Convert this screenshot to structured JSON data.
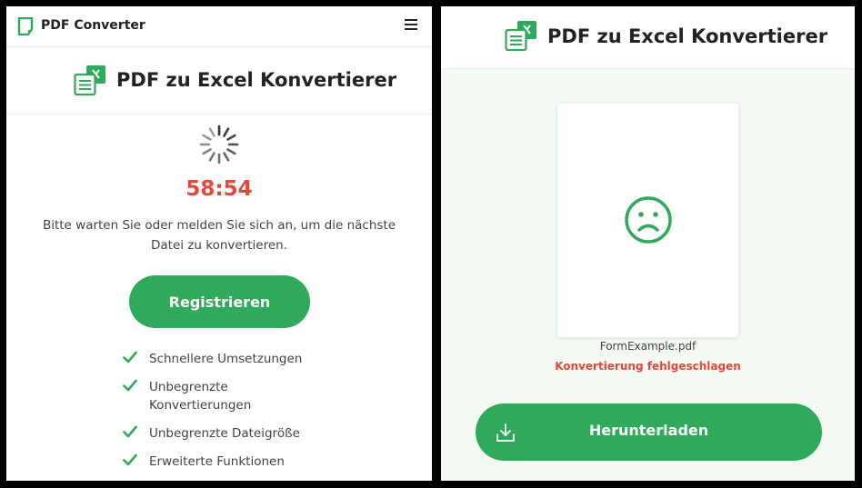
{
  "left": {
    "header": {
      "brand": "PDF Converter",
      "menu_icon": "hamburger-icon",
      "logo_icon": "pdf-converter-logo-icon"
    },
    "title": "PDF zu Excel Konvertierer",
    "timer": "58:54",
    "wait_message": "Bitte warten Sie oder melden Sie sich an, um die nächste Datei zu konvertieren.",
    "register_label": "Registrieren",
    "features": [
      "Schnellere Umsetzungen",
      "Unbegrenzte Konvertierungen",
      "Unbegrenzte Dateigröße",
      "Erweiterte Funktionen"
    ]
  },
  "right": {
    "title": "PDF zu Excel Konvertierer",
    "file_name": "FormExample.pdf",
    "status": "Konvertierung fehlgeschlagen",
    "download_label": "Herunterladen",
    "result_icon": "sad-face-icon"
  },
  "colors": {
    "accent": "#2faa5a",
    "error": "#e14a3b",
    "text": "#222222",
    "right_bg": "#f2faf3"
  }
}
